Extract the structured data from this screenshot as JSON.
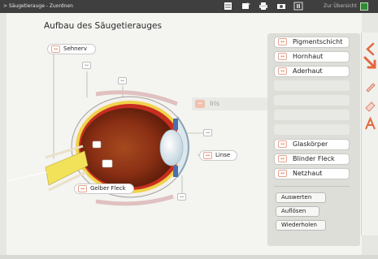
{
  "topbar": {
    "breadcrumb": "> Säugetierauge - Zuordnen",
    "overview_label": "Zur Übersicht",
    "icons": [
      "notes-icon",
      "tasks-icon",
      "print-icon",
      "camera-icon",
      "pause-icon",
      "exit-icon"
    ]
  },
  "main": {
    "title": "Aufbau des Säugetierauges",
    "diagram_labels": {
      "sehnerv": "Sehnerv",
      "linse": "Linse",
      "gelber_fleck": "Gelber Fleck",
      "iris": "Iris"
    },
    "chip_glyph": "↔"
  },
  "panel": {
    "answers": [
      "Pigmentschicht",
      "Hornhaut",
      "Aderhaut",
      "Glaskörper",
      "Blinder Fleck",
      "Netzhaut"
    ],
    "buttons": {
      "evaluate": "Auswerten",
      "solve": "Auflösen",
      "repeat": "Wiederholen"
    }
  },
  "colors": {
    "accent": "#e2673e",
    "chip_border": "#e7a48e",
    "panel_bg": "#deded9",
    "topbar_bg": "#3f3f3f"
  }
}
